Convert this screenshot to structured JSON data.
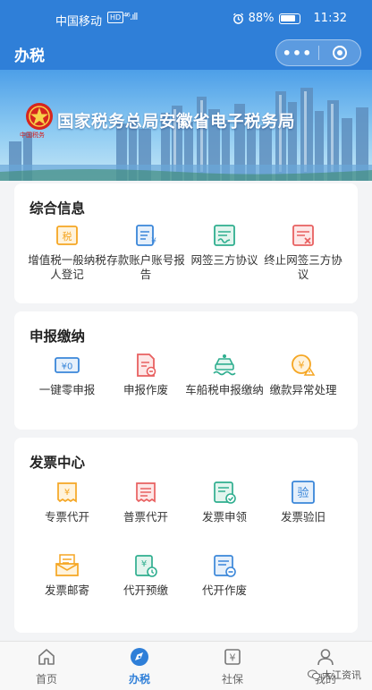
{
  "status_bar": {
    "carrier": "中国移动",
    "network_badge": "HD",
    "signal": "⁴⁶.ıll",
    "battery": "88%",
    "battery_level": 0.88,
    "time": "11:32"
  },
  "navbar": {
    "title": "办税",
    "more_icon": "•••"
  },
  "banner": {
    "title": "国家税务总局安徽省电子税务局",
    "emblem_caption": "中国税务"
  },
  "sections": [
    {
      "title": "综合信息",
      "items": [
        {
          "label": "增值税一般纳税人登记",
          "icon": "tax-register-icon",
          "glyph": "税"
        },
        {
          "label": "存款账户账号报告",
          "icon": "bank-account-icon"
        },
        {
          "label": "网签三方协议",
          "icon": "sign-agreement-icon"
        },
        {
          "label": "终止网签三方协议",
          "icon": "terminate-agreement-icon"
        }
      ]
    },
    {
      "title": "申报缴纳",
      "items": [
        {
          "label": "一键零申报",
          "icon": "zero-declare-icon",
          "glyph": "¥0"
        },
        {
          "label": "申报作废",
          "icon": "declare-void-icon"
        },
        {
          "label": "车船税申报缴纳",
          "icon": "vehicle-tax-icon"
        },
        {
          "label": "缴款异常处理",
          "icon": "payment-exception-icon"
        }
      ]
    },
    {
      "title": "发票中心",
      "items": [
        {
          "label": "专票代开",
          "icon": "special-invoice-icon"
        },
        {
          "label": "普票代开",
          "icon": "ordinary-invoice-icon"
        },
        {
          "label": "发票申领",
          "icon": "invoice-apply-icon"
        },
        {
          "label": "发票验旧",
          "icon": "invoice-verify-icon",
          "glyph": "验"
        },
        {
          "label": "发票邮寄",
          "icon": "invoice-mail-icon"
        },
        {
          "label": "代开预缴",
          "icon": "prepay-icon"
        },
        {
          "label": "代开作废",
          "icon": "issue-void-icon"
        }
      ]
    }
  ],
  "tabbar": [
    {
      "label": "首页",
      "icon": "home-icon"
    },
    {
      "label": "办税",
      "icon": "compass-icon",
      "active": true
    },
    {
      "label": "社保",
      "icon": "social-security-icon",
      "glyph": "¥"
    },
    {
      "label": "我的",
      "icon": "user-icon"
    }
  ],
  "watermark": "大江资讯",
  "colors": {
    "primary": "#2f7fd8",
    "icon_orange": "#f5a623",
    "icon_blue": "#3a86d9",
    "icon_green": "#2fae8f",
    "icon_red": "#e86060"
  }
}
